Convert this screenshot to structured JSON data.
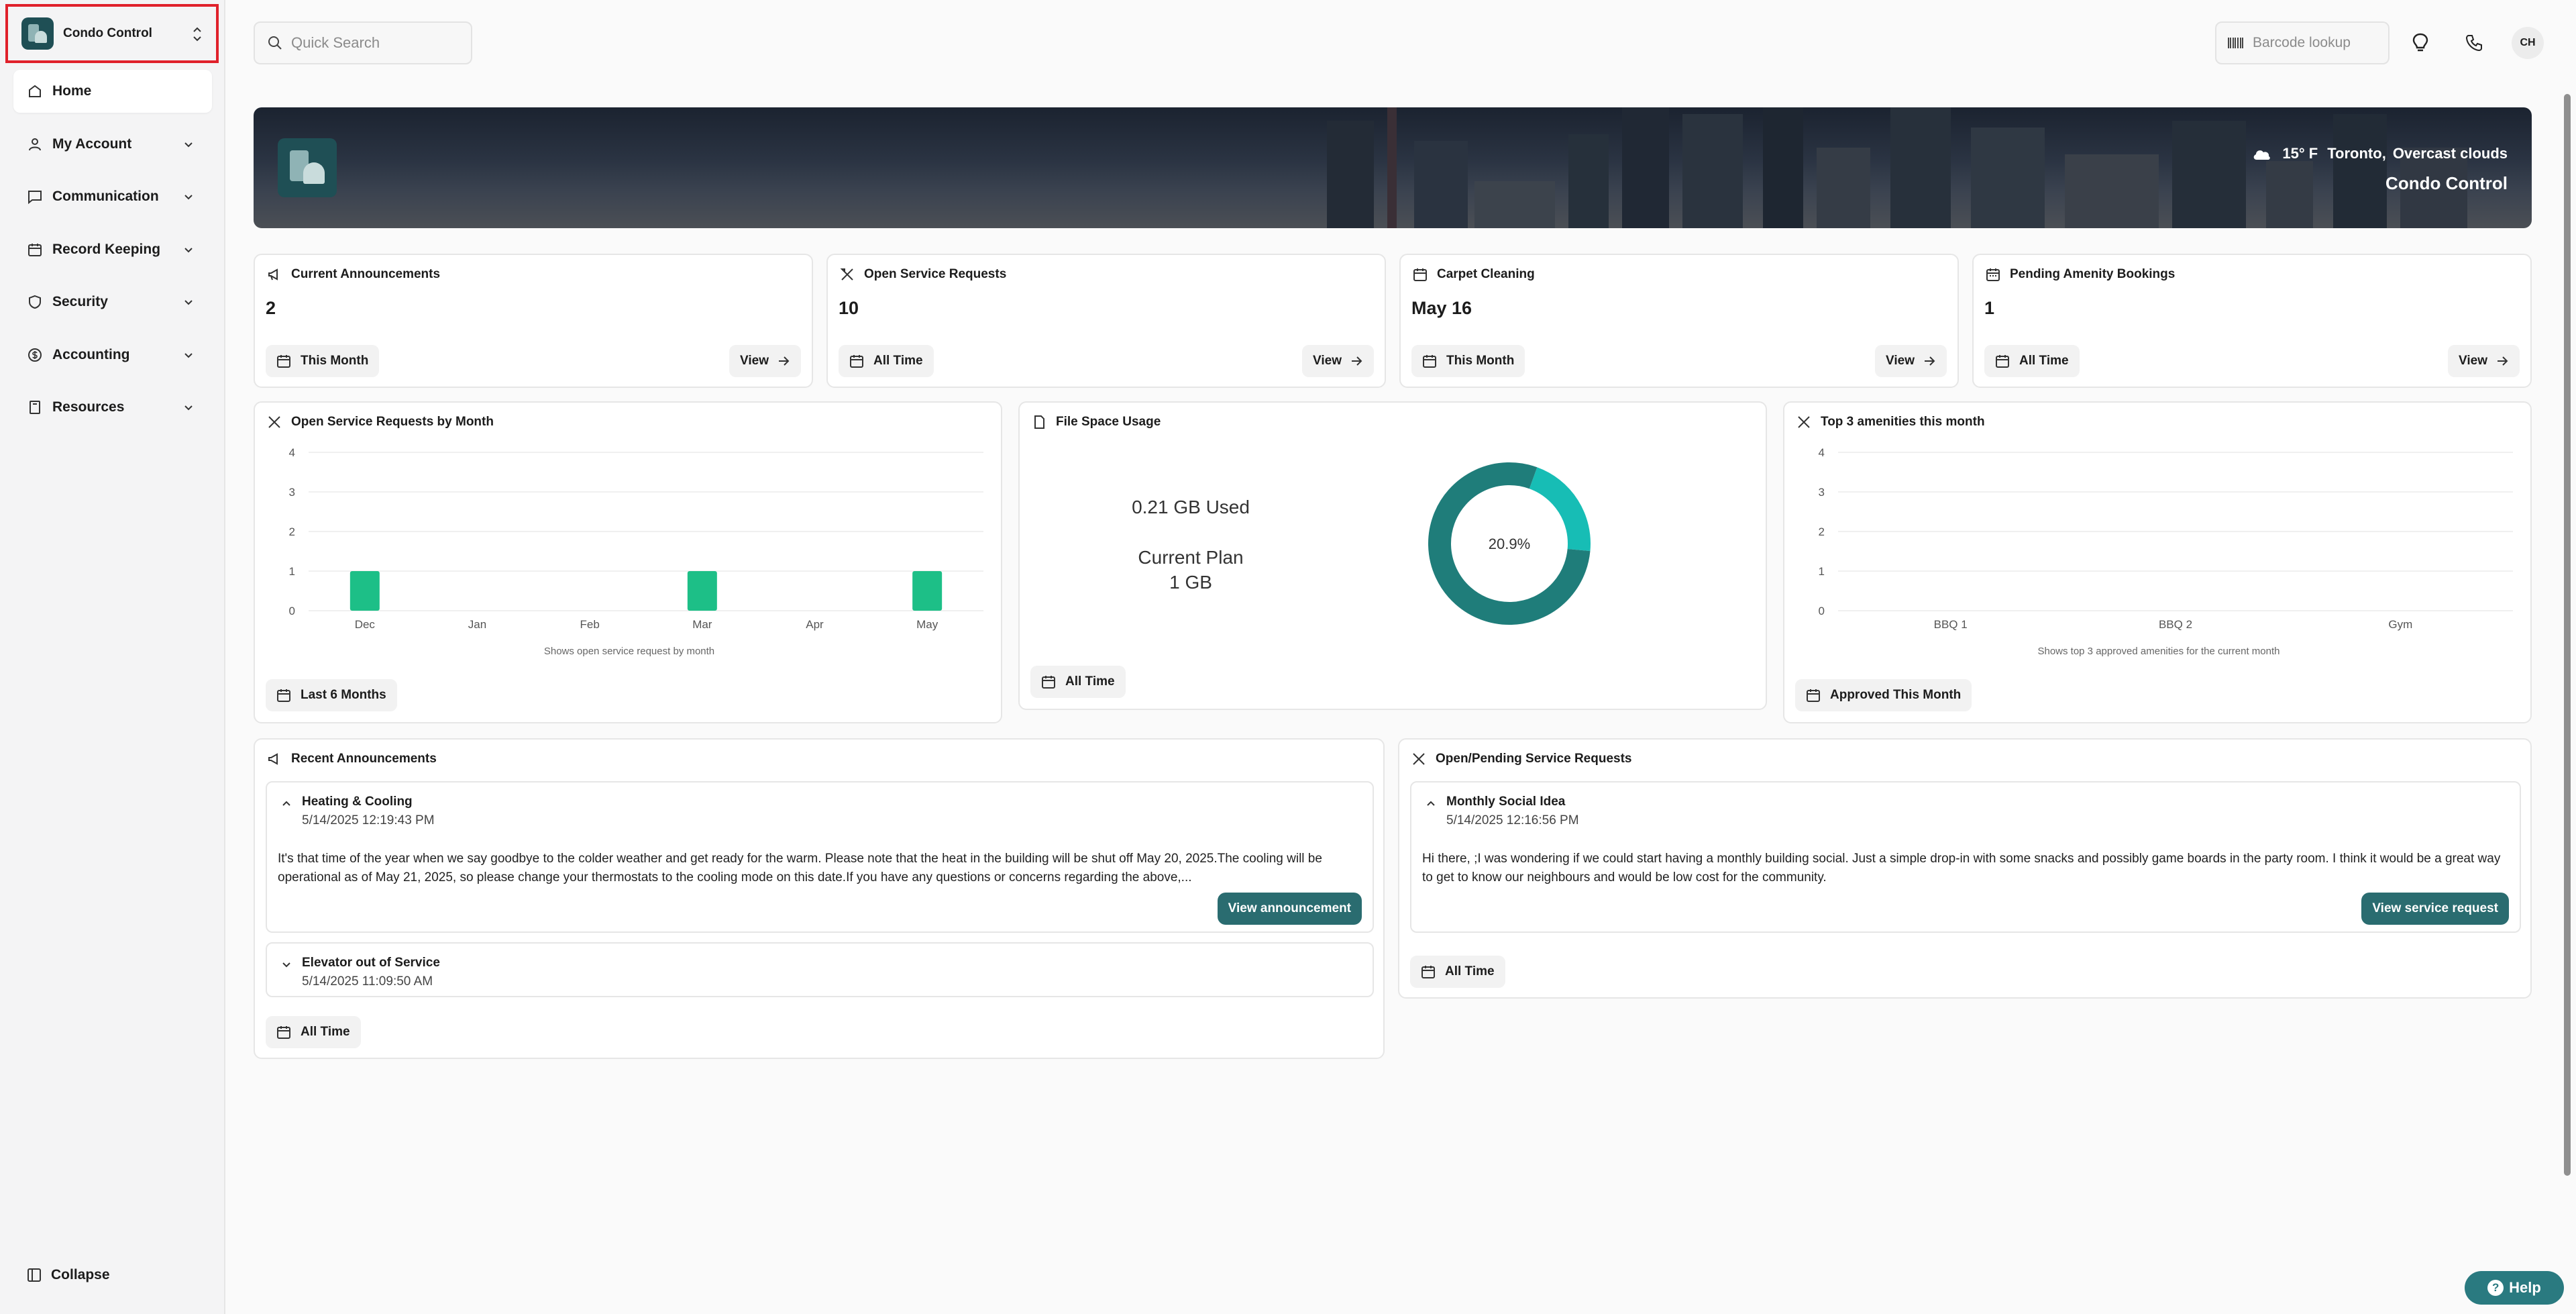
{
  "sidebar": {
    "org_name": "Condo Control",
    "items": [
      {
        "label": "Home"
      },
      {
        "label": "My Account"
      },
      {
        "label": "Communication"
      },
      {
        "label": "Record Keeping"
      },
      {
        "label": "Security"
      },
      {
        "label": "Accounting"
      },
      {
        "label": "Resources"
      }
    ],
    "collapse_label": "Collapse"
  },
  "topbar": {
    "search_placeholder": "Quick Search",
    "barcode_placeholder": "Barcode lookup",
    "avatar_initials": "CH"
  },
  "banner": {
    "temperature": "15° F",
    "city": "Toronto,",
    "condition": "Overcast clouds",
    "org_name": "Condo Control"
  },
  "stats": [
    {
      "title": "Current Announcements",
      "value": "2",
      "period": "This Month",
      "action": "View"
    },
    {
      "title": "Open Service Requests",
      "value": "10",
      "period": "All Time",
      "action": "View"
    },
    {
      "title": "Carpet Cleaning",
      "value": "May 16",
      "period": "This Month",
      "action": "View"
    },
    {
      "title": "Pending Amenity Bookings",
      "value": "1",
      "period": "All Time",
      "action": "View"
    }
  ],
  "charts": {
    "service_requests": {
      "title": "Open Service Requests by Month",
      "caption": "Shows open service request by month",
      "period": "Last 6 Months"
    },
    "file_space": {
      "title": "File Space Usage",
      "used": "0.21 GB Used",
      "plan_label": "Current Plan",
      "plan_size": "1 GB",
      "percent_label": "20.9%",
      "period": "All Time"
    },
    "amenities": {
      "title": "Top 3 amenities this month",
      "caption": "Shows top 3 approved amenities for the current month",
      "period": "Approved This Month"
    }
  },
  "chart_data": [
    {
      "type": "bar",
      "categories": [
        "Dec",
        "Jan",
        "Feb",
        "Mar",
        "Apr",
        "May"
      ],
      "values": [
        1,
        0,
        0,
        1,
        0,
        1
      ],
      "ylim": [
        0,
        4
      ],
      "yticks": [
        "0",
        "1",
        "2",
        "3",
        "4"
      ],
      "color": "#1dbf87"
    },
    {
      "type": "pie",
      "categories": [
        "Used",
        "Free"
      ],
      "values": [
        20.9,
        79.1
      ],
      "colors": [
        "#17bdb5",
        "#1f7d7a"
      ]
    },
    {
      "type": "bar",
      "categories": [
        "BBQ 1",
        "BBQ 2",
        "Gym"
      ],
      "values": [
        0,
        0,
        0
      ],
      "ylim": [
        0,
        4
      ],
      "yticks": [
        "0",
        "1",
        "2",
        "3",
        "4"
      ],
      "color": "#1dbf87"
    }
  ],
  "announcements": {
    "title": "Recent Announcements",
    "period": "All Time",
    "items": [
      {
        "title": "Heating & Cooling",
        "date": "5/14/2025 12:19:43 PM",
        "body": "It's that time of the year when we say goodbye to the colder weather and get ready for the warm. Please note that the heat in the building will be shut off May 20, 2025.The cooling will be operational as of May 21, 2025, so please change your thermostats to the cooling mode on this date.If you have any questions or concerns regarding the above,...",
        "action": "View announcement"
      },
      {
        "title": "Elevator out of Service",
        "date": "5/14/2025 11:09:50 AM"
      }
    ]
  },
  "service_requests": {
    "title": "Open/Pending Service Requests",
    "period": "All Time",
    "items": [
      {
        "title": "Monthly Social Idea",
        "date": "5/14/2025 12:16:56 PM",
        "body": "Hi there, ;I was wondering if we could start having a monthly building social. Just a simple drop-in with some snacks and possibly game boards in the party room. I think it would be a great way to get to know our neighbours and would be low cost for the community.",
        "action": "View service request"
      }
    ]
  },
  "help_label": "Help",
  "colors": {
    "accent": "#2a6c70",
    "bar": "#1dbf87",
    "donut_used": "#17bdb5",
    "donut_free": "#1f7d7a"
  }
}
